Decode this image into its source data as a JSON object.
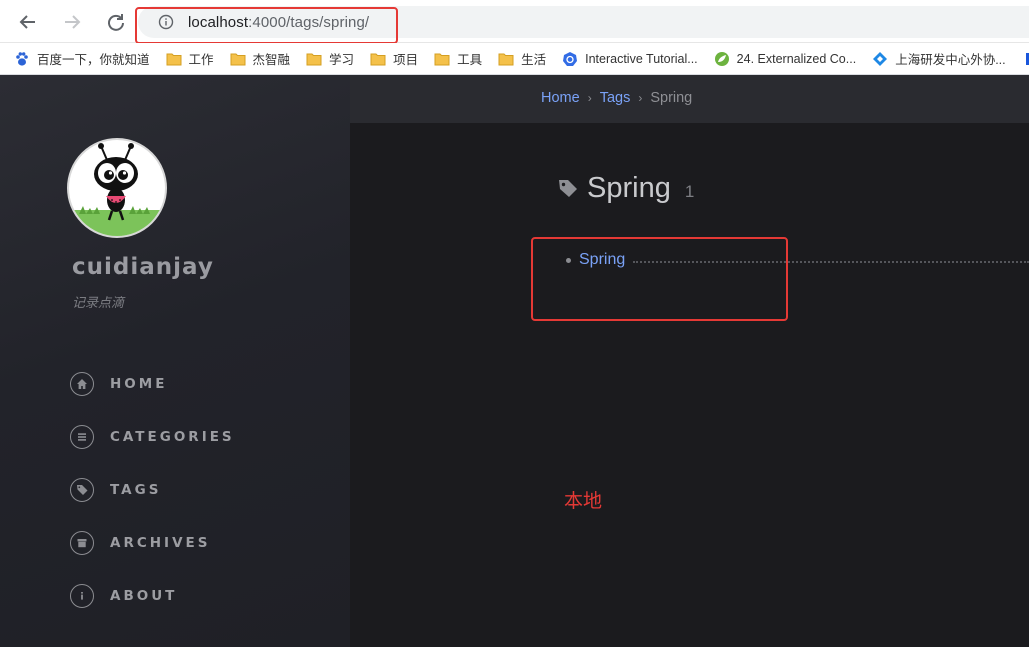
{
  "browser": {
    "url_host": "localhost",
    "url_path": ":4000/tags/spring/",
    "bookmarks": [
      {
        "label": "百度一下，你就知道",
        "icon": "baidu-paw-icon"
      },
      {
        "label": "工作",
        "icon": "folder-icon"
      },
      {
        "label": "杰智融",
        "icon": "folder-icon"
      },
      {
        "label": "学习",
        "icon": "folder-icon"
      },
      {
        "label": "项目",
        "icon": "folder-icon"
      },
      {
        "label": "工具",
        "icon": "folder-icon"
      },
      {
        "label": "生活",
        "icon": "folder-icon"
      },
      {
        "label": "Interactive Tutorial...",
        "icon": "kubernetes-icon"
      },
      {
        "label": "24. Externalized Co...",
        "icon": "spring-leaf-icon"
      },
      {
        "label": "上海研发中心外协...",
        "icon": "diamond-icon"
      }
    ]
  },
  "sidebar": {
    "site_title": "cuidianjay",
    "site_subtitle": "记录点滴",
    "nav": [
      {
        "label": "HOME",
        "icon": "home-icon"
      },
      {
        "label": "CATEGORIES",
        "icon": "list-icon"
      },
      {
        "label": "TAGS",
        "icon": "tags-icon"
      },
      {
        "label": "ARCHIVES",
        "icon": "archive-icon"
      },
      {
        "label": "ABOUT",
        "icon": "info-icon"
      }
    ]
  },
  "breadcrumb": {
    "home": "Home",
    "sep": "›",
    "tags": "Tags",
    "current": "Spring"
  },
  "tag_page": {
    "title": "Spring",
    "count": "1",
    "posts": [
      "Spring"
    ]
  },
  "annotation": "本地",
  "colors": {
    "accent_link": "#7aa2f7",
    "annotation_red": "#e53935",
    "sidebar_bg": "#25262c",
    "main_bg": "#1b1b1e"
  }
}
